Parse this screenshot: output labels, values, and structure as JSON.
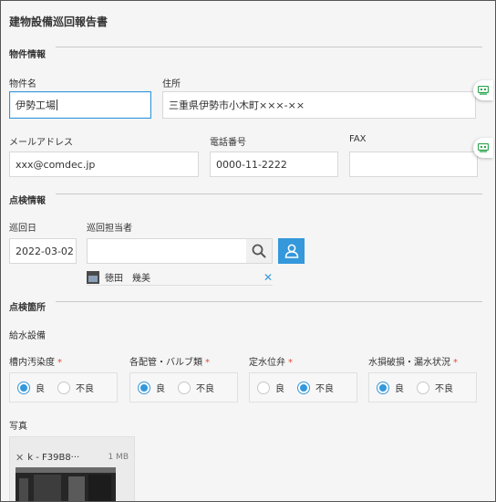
{
  "form": {
    "title": "建物設備巡回報告書"
  },
  "sections": {
    "property": "物件情報",
    "inspection": "点検情報",
    "locations": "点検箇所"
  },
  "property": {
    "name_label": "物件名",
    "name_value": "伊勢工場",
    "address_label": "住所",
    "address_value": "三重県伊勢市小木町×××-××",
    "email_label": "メールアドレス",
    "email_value": "xxx@comdec.jp",
    "phone_label": "電話番号",
    "phone_value": "0000-11-2222",
    "fax_label": "FAX",
    "fax_value": ""
  },
  "inspection": {
    "date_label": "巡回日",
    "date_value": "2022-03-02",
    "inspector_label": "巡回担当者",
    "inspector_search_value": "",
    "selected_user": "徳田　幾美",
    "remove_glyph": "✕"
  },
  "locations": {
    "group_label": "給水設備",
    "required_mark": "*",
    "items": [
      {
        "label": "槽内汚染度",
        "options": [
          "良",
          "不良"
        ],
        "selected": "良"
      },
      {
        "label": "各配管・バルブ類",
        "options": [
          "良",
          "不良"
        ],
        "selected": "良"
      },
      {
        "label": "定水位弁",
        "options": [
          "良",
          "不良"
        ],
        "selected": "不良"
      },
      {
        "label": "水損破損・漏水状況",
        "options": [
          "良",
          "不良"
        ],
        "selected": "良"
      }
    ],
    "photo_label": "写真",
    "file": {
      "remove_glyph": "✕",
      "name": "k - F39B8···",
      "size": "1 MB"
    }
  },
  "icons": {
    "side_button": "comment-icon",
    "search": "search-icon",
    "user": "user-icon"
  },
  "colors": {
    "accent": "#3498db",
    "required": "#e74c3c",
    "side_icon": "#2ea44f"
  }
}
